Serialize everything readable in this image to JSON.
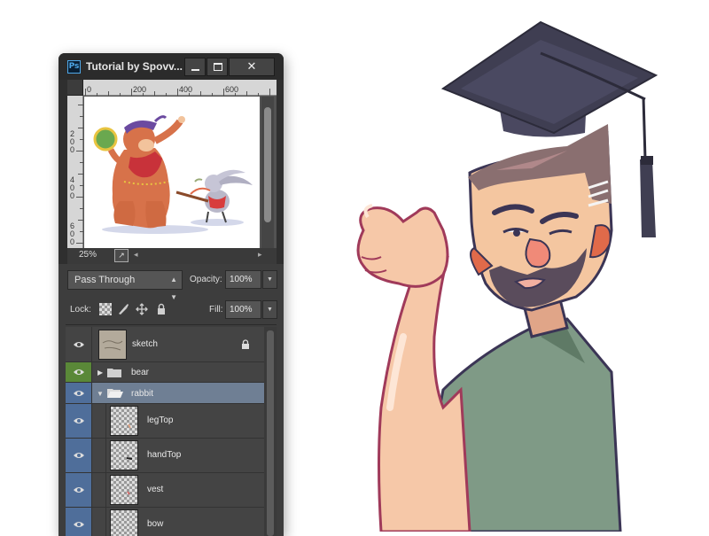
{
  "window": {
    "title": "Tutorial by Spovv...",
    "app_badge": "Ps",
    "minimize_symbol": "",
    "close_symbol": "✕"
  },
  "navigator": {
    "ruler_top_ticks": [
      "0",
      "200",
      "400",
      "600"
    ],
    "ruler_left_ticks": [
      "2 0 0",
      "4 0 0",
      "6 0 0"
    ],
    "zoom": "25%"
  },
  "layers_panel": {
    "blend_mode": "Pass Through",
    "opacity_label": "Opacity:",
    "opacity_value": "100%",
    "lock_label": "Lock:",
    "fill_label": "Fill:",
    "fill_value": "100%",
    "layers": [
      {
        "name": "sketch",
        "type": "layer",
        "locked": true
      },
      {
        "name": "bear",
        "type": "group",
        "expanded": false
      },
      {
        "name": "rabbit",
        "type": "group",
        "expanded": true,
        "selected": true
      },
      {
        "name": "legTop",
        "type": "layer"
      },
      {
        "name": "handTop",
        "type": "layer"
      },
      {
        "name": "vest",
        "type": "layer"
      },
      {
        "name": "bow",
        "type": "layer"
      }
    ]
  },
  "colors": {
    "panel_bg": "#3d3d3d",
    "selected_row": "#6f7f94",
    "eye_blue": "#4f6e9a",
    "eye_green": "#5a8838"
  }
}
